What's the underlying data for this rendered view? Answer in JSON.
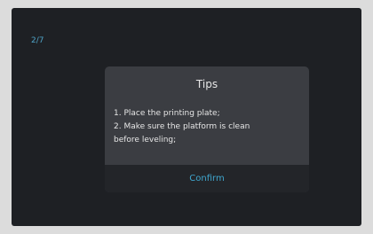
{
  "screen": {
    "page_indicator": "2/7"
  },
  "dialog": {
    "title": "Tips",
    "lines": [
      "1. Place the printing plate;",
      "2. Make sure the platform is clean",
      "before leveling;"
    ],
    "confirm_label": "Confirm"
  },
  "colors": {
    "accent": "#3fa7cf",
    "screen_bg": "#1e2024",
    "dialog_bg": "#3b3d42"
  }
}
